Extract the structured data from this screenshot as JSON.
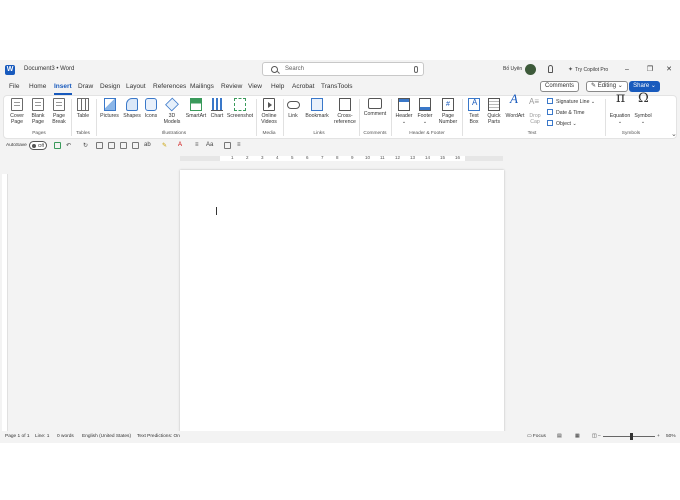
{
  "titlebar": {
    "logo": "W",
    "doc_title": "Document3  •  Word",
    "search_placeholder": "Search",
    "user_name": "Bố Uyên",
    "copilot": "Try Copilot Pro",
    "minimize": "–",
    "restore": "❐",
    "close": "✕"
  },
  "tabs": [
    "File",
    "Home",
    "Insert",
    "Draw",
    "Design",
    "Layout",
    "References",
    "Mailings",
    "Review",
    "View",
    "Help",
    "Acrobat",
    "TransTools"
  ],
  "active_tab": "Insert",
  "toolbar_right": {
    "comments": "Comments",
    "editing": "Editing",
    "share": "Share"
  },
  "ribbon": {
    "pages": {
      "cover_top": "Cover",
      "cover_bottom": "Page",
      "blank_top": "Blank",
      "blank_bottom": "Page",
      "break_top": "Page",
      "break_bottom": "Break",
      "group": "Pages"
    },
    "tables": {
      "table": "Table",
      "group": "Tables"
    },
    "illustrations": {
      "pictures": "Pictures",
      "shapes": "Shapes",
      "icons": "Icons",
      "models_top": "3D",
      "models_bottom": "Models",
      "smartart": "SmartArt",
      "chart": "Chart",
      "screenshot": "Screenshot",
      "group": "Illustrations"
    },
    "media": {
      "video_top": "Online",
      "video_bottom": "Videos",
      "group": "Media"
    },
    "links": {
      "link": "Link",
      "bookmark": "Bookmark",
      "cross_top": "Cross-",
      "cross_bottom": "reference",
      "group": "Links"
    },
    "comments": {
      "comment": "Comment",
      "group": "Comments"
    },
    "header_footer": {
      "header": "Header",
      "footer": "Footer",
      "pgnum_top": "Page",
      "pgnum_bottom": "Number",
      "group": "Header & Footer"
    },
    "text": {
      "textbox_top": "Text",
      "textbox_bottom": "Box",
      "quick_top": "Quick",
      "quick_bottom": "Parts",
      "wordart": "WordArt",
      "dropcap_top": "Drop",
      "dropcap_bottom": "Cap",
      "signature": "Signature Line",
      "datetime": "Date & Time",
      "object": "Object",
      "group": "Text"
    },
    "symbols": {
      "equation": "Equation",
      "symbol": "Symbol",
      "group": "Symbols"
    }
  },
  "qat": {
    "autosave": "AutoSave",
    "toggle": "Off",
    "font_label": "Aa"
  },
  "ruler_numbers": [
    "1",
    "2",
    "3",
    "4",
    "5",
    "6",
    "7",
    "8",
    "9",
    "10",
    "11",
    "12",
    "13",
    "14",
    "15",
    "16"
  ],
  "statusbar": {
    "page": "Page 1 of 1",
    "line": "Line: 1",
    "words": "0 words",
    "language": "English (United States)",
    "predictions": "Text Predictions: On",
    "focus": "Focus",
    "zoom": "50%"
  },
  "colors": {
    "accent": "#185abd",
    "background": "#f3f3f3"
  }
}
